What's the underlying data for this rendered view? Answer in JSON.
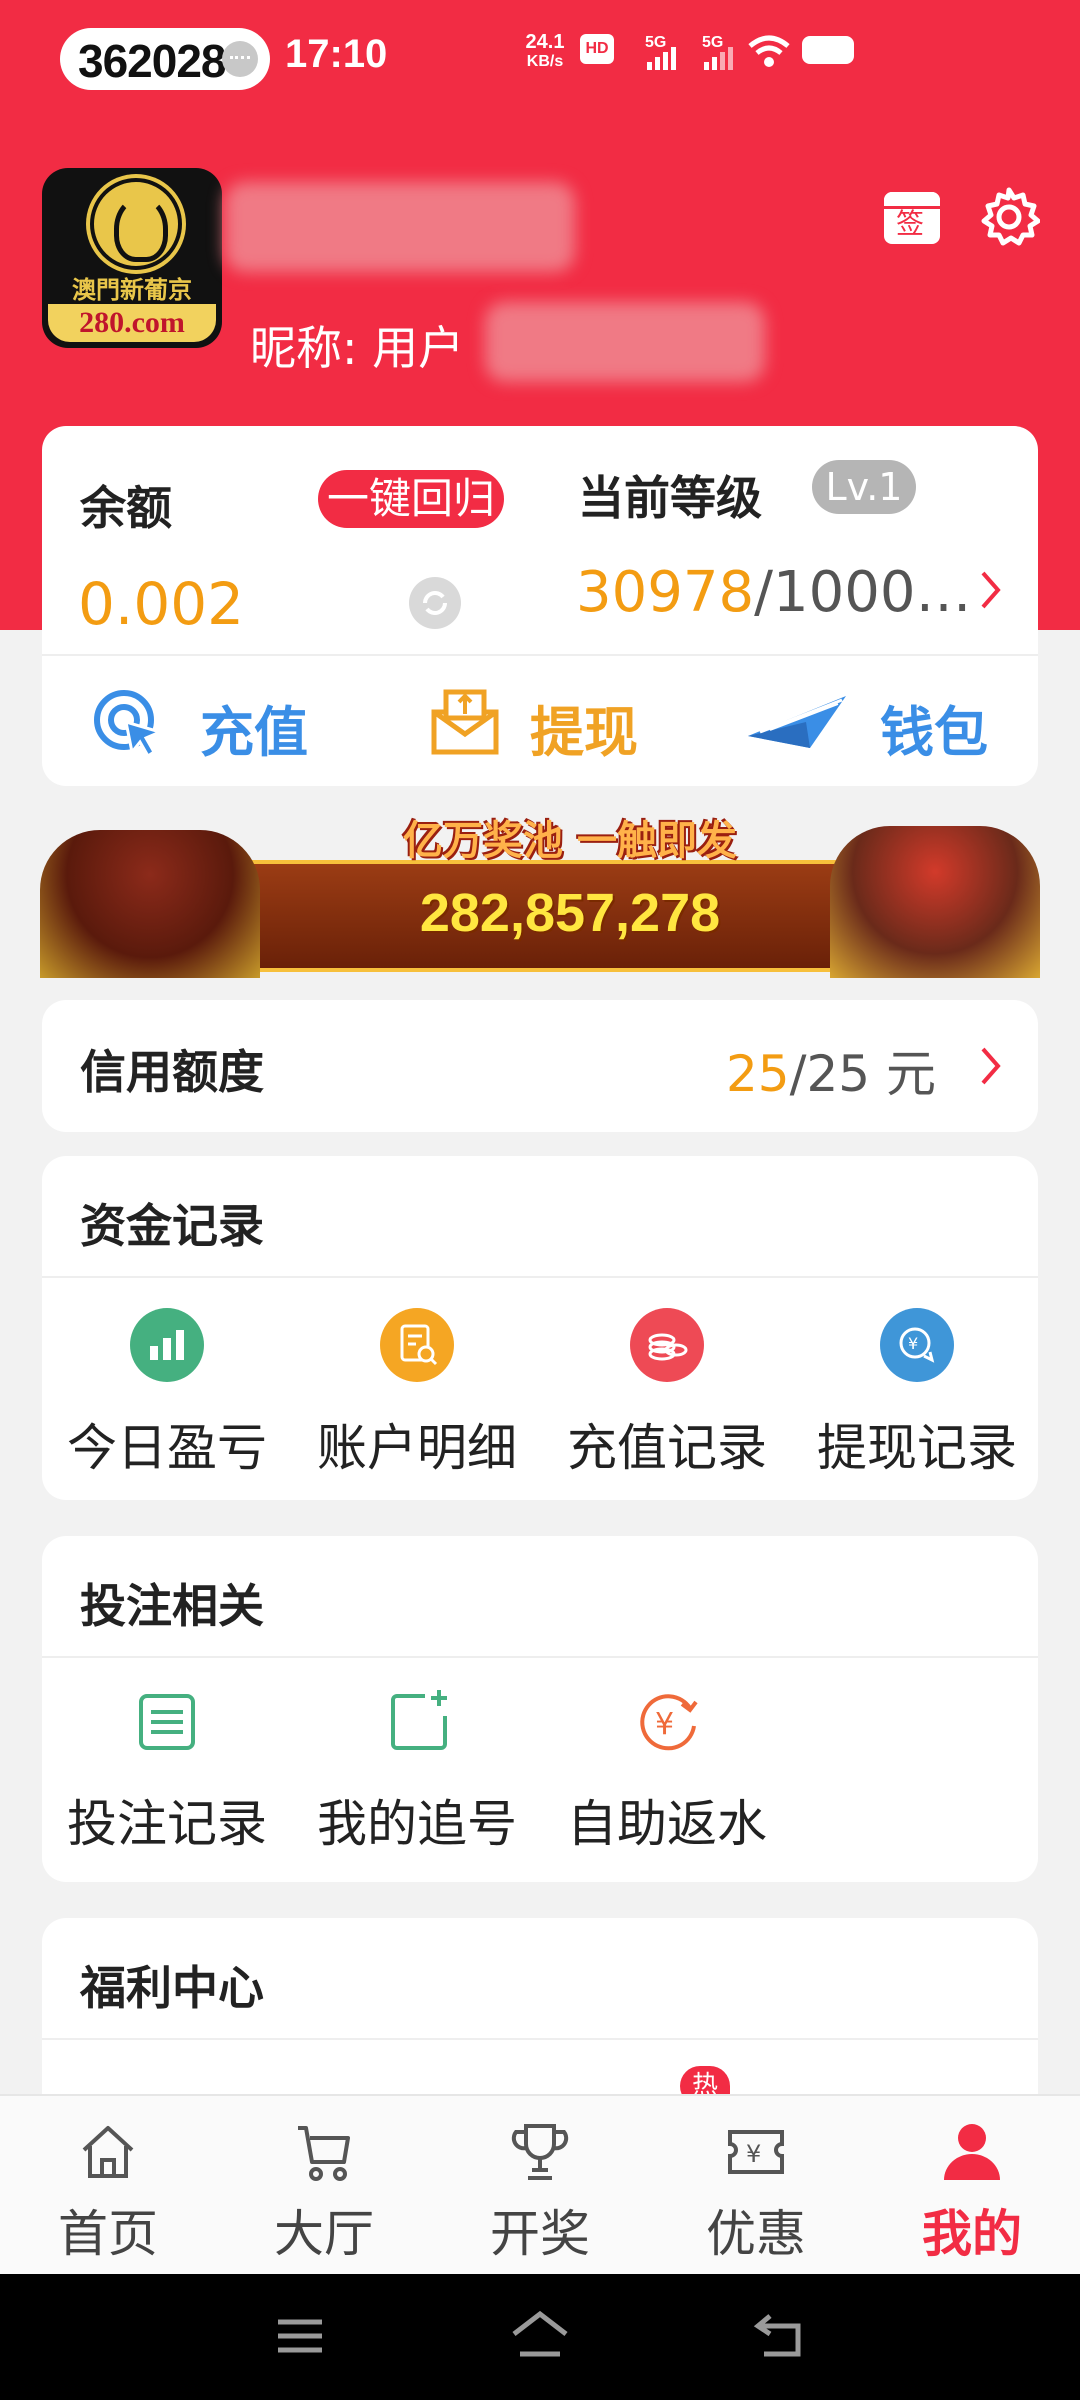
{
  "status_bar": {
    "carrier_number": "362028",
    "time": "17:10",
    "net_speed_value": "24.1",
    "net_speed_unit": "KB/s",
    "hd_badge": "HD",
    "sim1_label": "5G",
    "sim2_label": "5G",
    "icons": [
      "chat-bubble-icon",
      "hd-voice-icon",
      "signal-icon",
      "wifi-icon",
      "battery-icon"
    ]
  },
  "profile": {
    "logo_cn": "澳門新葡京",
    "logo_site": "280.com",
    "nickname_label": "昵称: 用户",
    "checkin_icon_text": "签",
    "icons": [
      "checkin-calendar-icon",
      "settings-gear-icon"
    ]
  },
  "balance_card": {
    "balance_label": "余额",
    "one_key_return": "一键回归",
    "balance_value": "0.002",
    "level_label": "当前等级",
    "level_badge": "Lv.1",
    "level_current": "30978",
    "level_target": "/1000…",
    "actions": [
      {
        "label": "充值",
        "icon": "deposit-cursor-icon",
        "color": "#3a8ee6"
      },
      {
        "label": "提现",
        "icon": "withdraw-envelope-icon",
        "color": "#f0a224"
      },
      {
        "label": "钱包",
        "icon": "wallet-plane-icon",
        "color": "#3a8ee6"
      }
    ]
  },
  "banner": {
    "headline": "亿万奖池 一触即发",
    "jackpot": "282,857,278"
  },
  "credit": {
    "label": "信用额度",
    "used": "25",
    "total": "/25 元"
  },
  "fund_records": {
    "title": "资金记录",
    "items": [
      {
        "label": "今日盈亏",
        "icon": "bar-chart-icon",
        "color": "#45b080"
      },
      {
        "label": "账户明细",
        "icon": "document-search-icon",
        "color": "#f5a623"
      },
      {
        "label": "充值记录",
        "icon": "coins-icon",
        "color": "#ee4a55"
      },
      {
        "label": "提现记录",
        "icon": "yuan-exchange-icon",
        "color": "#3f96d8"
      }
    ]
  },
  "betting": {
    "title": "投注相关",
    "items": [
      {
        "label": "投注记录",
        "icon": "list-document-icon",
        "color": "#45b080"
      },
      {
        "label": "我的追号",
        "icon": "add-square-icon",
        "color": "#45b080"
      },
      {
        "label": "自助返水",
        "icon": "yuan-refresh-icon",
        "color": "#ef6a3a"
      }
    ]
  },
  "welfare": {
    "title": "福利中心",
    "hot_badge": "热"
  },
  "tabbar": {
    "active_color": "#f22c44",
    "items": [
      {
        "label": "首页",
        "icon": "home-icon",
        "active": false
      },
      {
        "label": "大厅",
        "icon": "cart-icon",
        "active": false
      },
      {
        "label": "开奖",
        "icon": "trophy-icon",
        "active": false
      },
      {
        "label": "优惠",
        "icon": "coupon-icon",
        "active": false
      },
      {
        "label": "我的",
        "icon": "user-icon",
        "active": true
      }
    ]
  },
  "system_nav": {
    "icons": [
      "menu-icon",
      "home-nav-icon",
      "back-icon"
    ]
  }
}
